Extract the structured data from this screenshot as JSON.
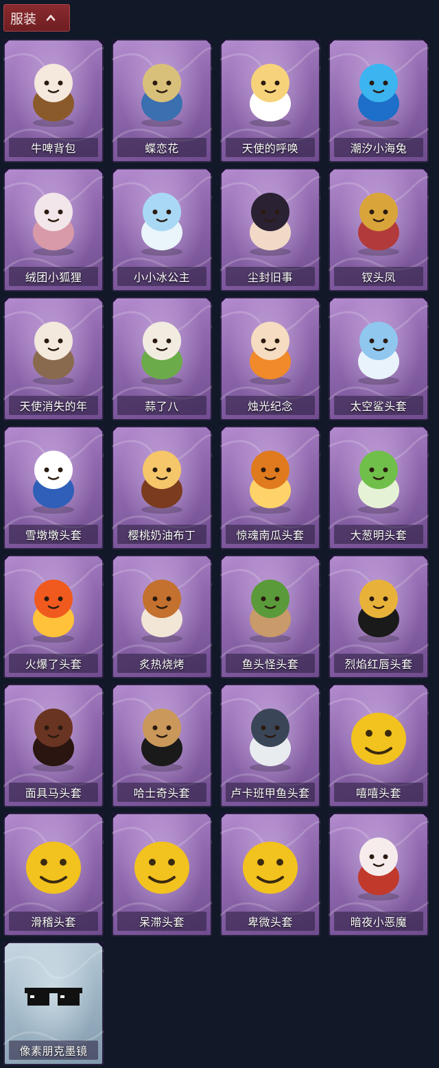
{
  "header": {
    "title": "服装",
    "toggle_icon": "chevron-up-icon"
  },
  "items": [
    {
      "name": "牛啤背包",
      "art": "cow-barrel-icon",
      "theme": "purple",
      "c1": "#f4e9dc",
      "c2": "#8b5a2b"
    },
    {
      "name": "蝶恋花",
      "art": "butterfly-bell-icon",
      "theme": "purple",
      "c1": "#d8c07a",
      "c2": "#3a6fb0"
    },
    {
      "name": "天使的呼唤",
      "art": "angel-charm-icon",
      "theme": "purple",
      "c1": "#f6d37a",
      "c2": "#ffffff"
    },
    {
      "name": "潮汐小海兔",
      "art": "blue-creature-icon",
      "theme": "purple",
      "c1": "#3bb4f0",
      "c2": "#1e6fc9"
    },
    {
      "name": "绒团小狐狸",
      "art": "fox-charm-icon",
      "theme": "purple",
      "c1": "#f2e6ea",
      "c2": "#d89aa8"
    },
    {
      "name": "小小冰公主",
      "art": "ice-princess-icon",
      "theme": "purple",
      "c1": "#a9d8f5",
      "c2": "#e9f4fb"
    },
    {
      "name": "尘封旧事",
      "art": "dark-prince-icon",
      "theme": "purple",
      "c1": "#2a2233",
      "c2": "#f1d9c7"
    },
    {
      "name": "钗头凤",
      "art": "phoenix-crown-icon",
      "theme": "purple",
      "c1": "#d9a53a",
      "c2": "#b23a3a"
    },
    {
      "name": "天使消失的年",
      "art": "veiled-angel-icon",
      "theme": "purple",
      "c1": "#f3e9dc",
      "c2": "#8a6a4e"
    },
    {
      "name": "蒜了八",
      "art": "garlic-icon",
      "theme": "purple",
      "c1": "#f2ece0",
      "c2": "#6cab4a"
    },
    {
      "name": "烛光纪念",
      "art": "candle-icon",
      "theme": "purple",
      "c1": "#f6dcc0",
      "c2": "#f08a2a"
    },
    {
      "name": "太空鲨头套",
      "art": "shark-head-icon",
      "theme": "purple",
      "c1": "#8fc7ef",
      "c2": "#e9f3fb"
    },
    {
      "name": "雪墩墩头套",
      "art": "snowman-head-icon",
      "theme": "purple",
      "c1": "#ffffff",
      "c2": "#2f5fb8"
    },
    {
      "name": "樱桃奶油布丁",
      "art": "pudding-icon",
      "theme": "purple",
      "c1": "#f5c66a",
      "c2": "#7a3b1f"
    },
    {
      "name": "惊魂南瓜头套",
      "art": "pumpkin-icon",
      "theme": "purple",
      "c1": "#e07a1e",
      "c2": "#ffd36a"
    },
    {
      "name": "大葱明头套",
      "art": "scallion-icon",
      "theme": "purple",
      "c1": "#6fbf4a",
      "c2": "#e6f2d6"
    },
    {
      "name": "火爆了头套",
      "art": "fire-head-icon",
      "theme": "purple",
      "c1": "#f05a1e",
      "c2": "#ffc23a"
    },
    {
      "name": "炙热烧烤",
      "art": "bbq-meat-icon",
      "theme": "purple",
      "c1": "#c4702e",
      "c2": "#f2e6d6"
    },
    {
      "name": "鱼头怪头套",
      "art": "fish-mask-icon",
      "theme": "purple",
      "c1": "#5a9a3a",
      "c2": "#c99a6a"
    },
    {
      "name": "烈焰红唇头套",
      "art": "yellow-mask-icon",
      "theme": "purple",
      "c1": "#e8b23a",
      "c2": "#1a1a1a"
    },
    {
      "name": "面具马头套",
      "art": "horse-mask-icon",
      "theme": "purple",
      "c1": "#6a3422",
      "c2": "#2a1510"
    },
    {
      "name": "哈士奇头套",
      "art": "dog-mask-icon",
      "theme": "purple",
      "c1": "#c9985a",
      "c2": "#1a1a1a"
    },
    {
      "name": "卢卡班甲鱼头套",
      "art": "fish-head-icon",
      "theme": "purple",
      "c1": "#3a4658",
      "c2": "#e8ecef"
    },
    {
      "name": "嘻嘻头套",
      "art": "grin-emoji-icon",
      "theme": "purple",
      "c1": "#f2c21e",
      "c2": "#3a2a10"
    },
    {
      "name": "滑稽头套",
      "art": "smirk-emoji-icon",
      "theme": "purple",
      "c1": "#f2c21e",
      "c2": "#3a2a10"
    },
    {
      "name": "呆滞头套",
      "art": "stare-emoji-icon",
      "theme": "purple",
      "c1": "#f2c21e",
      "c2": "#3a2a10"
    },
    {
      "name": "卑微头套",
      "art": "shy-emoji-icon",
      "theme": "purple",
      "c1": "#f2c21e",
      "c2": "#3a2a10"
    },
    {
      "name": "暗夜小恶魔",
      "art": "devil-mask-icon",
      "theme": "purple",
      "c1": "#f6ecec",
      "c2": "#c0392b"
    },
    {
      "name": "像素朋克墨镜",
      "art": "pixel-sunglasses-icon",
      "theme": "blue",
      "c1": "#111111",
      "c2": "#ffffff"
    }
  ]
}
